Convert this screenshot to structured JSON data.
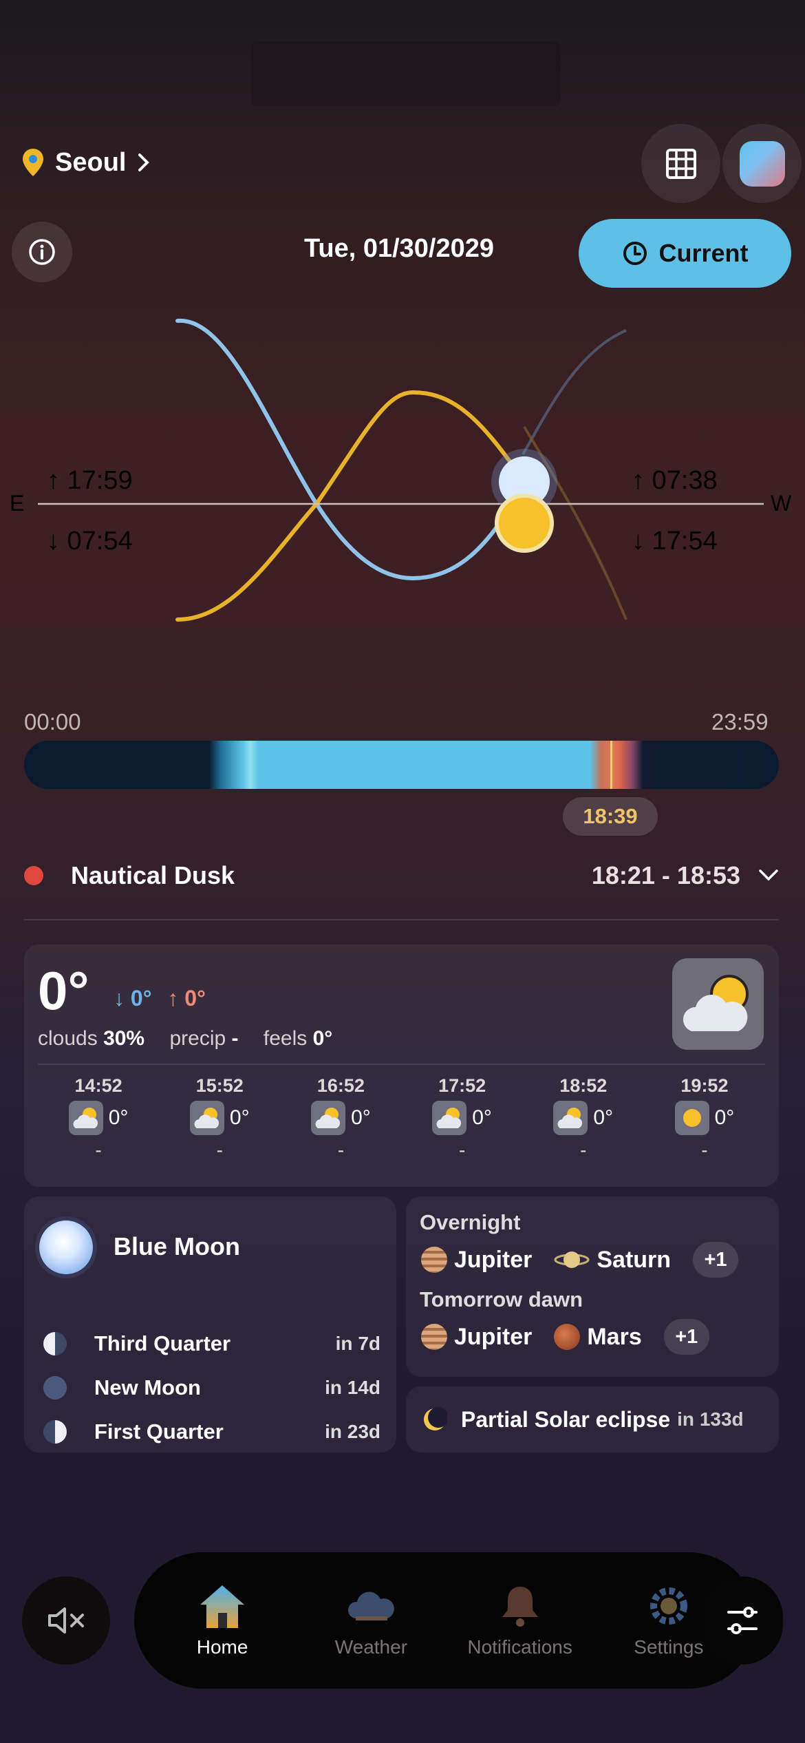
{
  "location": {
    "name": "Seoul"
  },
  "header": {
    "date": "Tue, 01/30/2029",
    "current_label": "Current"
  },
  "sun_moon": {
    "east_label": "E",
    "west_label": "W",
    "east_rise": "↑ 17:59",
    "east_set": "↓ 07:54",
    "west_rise": "↑ 07:38",
    "west_set": "↓ 17:54"
  },
  "timeline": {
    "start": "00:00",
    "end": "23:59",
    "current": "18:39"
  },
  "phase": {
    "name": "Nautical Dusk",
    "range": "18:21 - 18:53",
    "color": "#e0483e"
  },
  "weather": {
    "temp": "0°",
    "low": "↓ 0°",
    "high": "↑ 0°",
    "clouds_label": "clouds",
    "clouds_value": "30%",
    "precip_label": "precip",
    "precip_value": "-",
    "feels_label": "feels",
    "feels_value": "0°",
    "hourly": [
      {
        "time": "14:52",
        "temp": "0°",
        "precip": "-",
        "icon": "partly-cloudy-icon"
      },
      {
        "time": "15:52",
        "temp": "0°",
        "precip": "-",
        "icon": "partly-cloudy-icon"
      },
      {
        "time": "16:52",
        "temp": "0°",
        "precip": "-",
        "icon": "partly-cloudy-icon"
      },
      {
        "time": "17:52",
        "temp": "0°",
        "precip": "-",
        "icon": "partly-cloudy-icon"
      },
      {
        "time": "18:52",
        "temp": "0°",
        "precip": "-",
        "icon": "partly-cloudy-icon"
      },
      {
        "time": "19:52",
        "temp": "0°",
        "precip": "-",
        "icon": "sun-icon"
      }
    ]
  },
  "moon": {
    "title": "Blue Moon",
    "phases": [
      {
        "name": "Third Quarter",
        "in": "in 7d"
      },
      {
        "name": "New Moon",
        "in": "in 14d"
      },
      {
        "name": "First Quarter",
        "in": "in 23d"
      }
    ]
  },
  "planets": {
    "overnight_label": "Overnight",
    "overnight": [
      "Jupiter",
      "Saturn"
    ],
    "overnight_more": "+1",
    "dawn_label": "Tomorrow dawn",
    "dawn": [
      "Jupiter",
      "Mars"
    ],
    "dawn_more": "+1"
  },
  "eclipse": {
    "name": "Partial Solar eclipse",
    "in": "in 133d"
  },
  "nav": {
    "items": [
      {
        "label": "Home",
        "icon": "home-icon"
      },
      {
        "label": "Weather",
        "icon": "cloud-icon"
      },
      {
        "label": "Notifications",
        "icon": "bell-icon"
      },
      {
        "label": "Settings",
        "icon": "gear-icon"
      }
    ]
  },
  "colors": {
    "accent": "#5ec0e6",
    "sun": "#e8b22a",
    "moon": "#8fc3ea",
    "highlight": "#f0c46b"
  }
}
